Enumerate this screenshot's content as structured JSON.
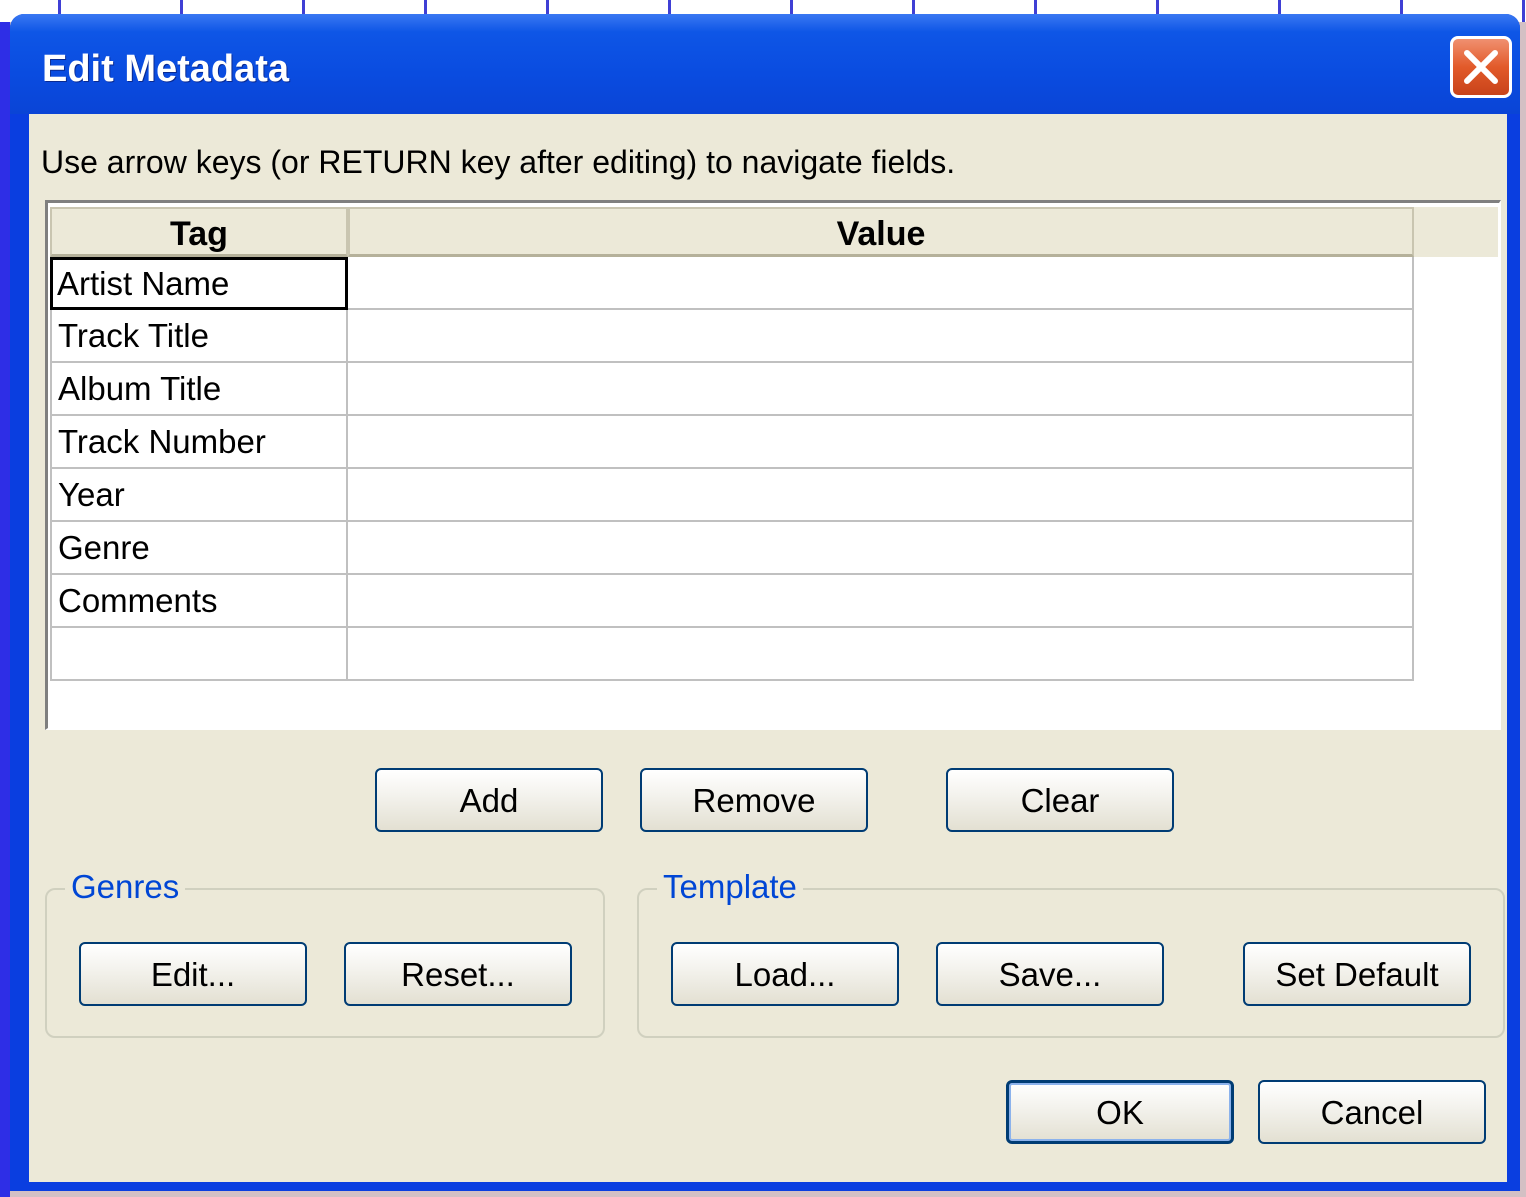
{
  "dialog": {
    "title": "Edit Metadata",
    "instructions": "Use arrow keys (or RETURN key after editing) to navigate fields."
  },
  "table": {
    "headers": {
      "tag": "Tag",
      "value": "Value"
    },
    "rows": [
      {
        "tag": "Artist Name",
        "value": ""
      },
      {
        "tag": "Track Title",
        "value": ""
      },
      {
        "tag": "Album Title",
        "value": ""
      },
      {
        "tag": "Track Number",
        "value": ""
      },
      {
        "tag": "Year",
        "value": ""
      },
      {
        "tag": "Genre",
        "value": ""
      },
      {
        "tag": "Comments",
        "value": ""
      },
      {
        "tag": "",
        "value": ""
      }
    ]
  },
  "row_buttons": {
    "add": "Add",
    "remove": "Remove",
    "clear": "Clear"
  },
  "genres": {
    "label": "Genres",
    "edit": "Edit...",
    "reset": "Reset..."
  },
  "template": {
    "label": "Template",
    "load": "Load...",
    "save": "Save...",
    "set_default": "Set Default"
  },
  "footer": {
    "ok": "OK",
    "cancel": "Cancel"
  },
  "colors": {
    "titlebar": "#0a4ce0",
    "client": "#ece9d8",
    "group_label": "#0046d5",
    "close": "#e25a2a"
  },
  "icons": {
    "close": "close-icon"
  }
}
